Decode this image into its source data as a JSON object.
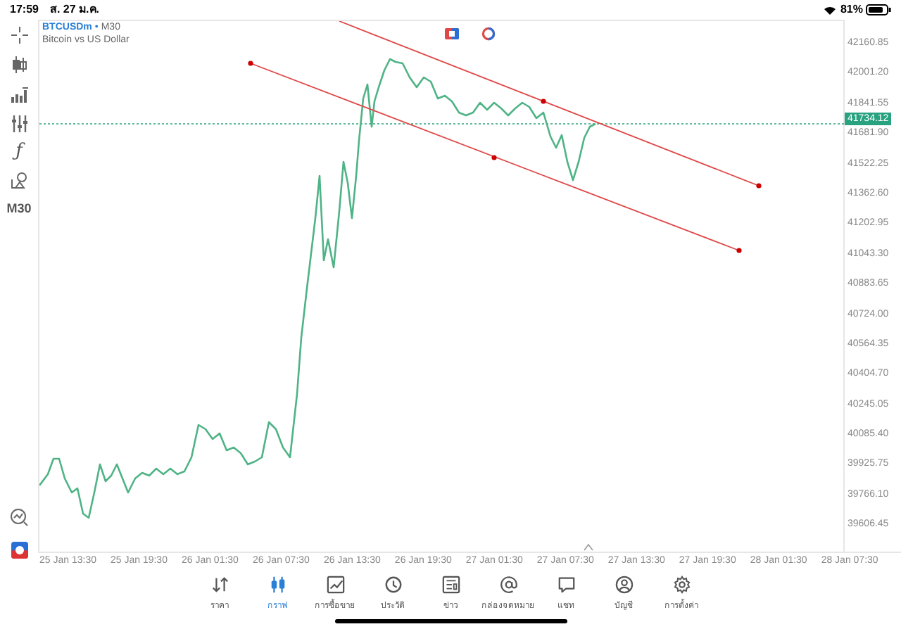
{
  "status_bar": {
    "time": "17:59",
    "date": "ส. 27 ม.ค.",
    "battery": "81%"
  },
  "toolbar": {
    "function_glyph": "ƒ",
    "timeframe": "M30"
  },
  "chart": {
    "symbol": "BTCUSDm",
    "separator": "•",
    "timeframe": "M30",
    "description": "Bitcoin vs US Dollar",
    "current_price": "41734.12",
    "price_axis": [
      "42160.85",
      "42001.20",
      "41841.55",
      "41681.90",
      "41522.25",
      "41362.60",
      "41202.95",
      "41043.30",
      "40883.65",
      "40724.00",
      "40564.35",
      "40404.70",
      "40245.05",
      "40085.40",
      "39925.75",
      "39766.10",
      "39606.45"
    ],
    "time_axis": [
      "25 Jan 13:30",
      "25 Jan 19:30",
      "26 Jan 01:30",
      "26 Jan 07:30",
      "26 Jan 13:30",
      "26 Jan 19:30",
      "27 Jan 01:30",
      "27 Jan 07:30",
      "27 Jan 13:30",
      "27 Jan 19:30",
      "28 Jan 01:30",
      "28 Jan 07:30"
    ]
  },
  "nav": [
    {
      "label": "ราคา",
      "selected": false
    },
    {
      "label": "กราฟ",
      "selected": true
    },
    {
      "label": "การซื้อขาย",
      "selected": false
    },
    {
      "label": "ประวัติ",
      "selected": false
    },
    {
      "label": "ข่าว",
      "selected": false
    },
    {
      "label": "กล่องจดหมาย",
      "selected": false
    },
    {
      "label": "แชท",
      "selected": false
    },
    {
      "label": "บัญชี",
      "selected": false
    },
    {
      "label": "การตั้งค่า",
      "selected": false
    }
  ]
}
